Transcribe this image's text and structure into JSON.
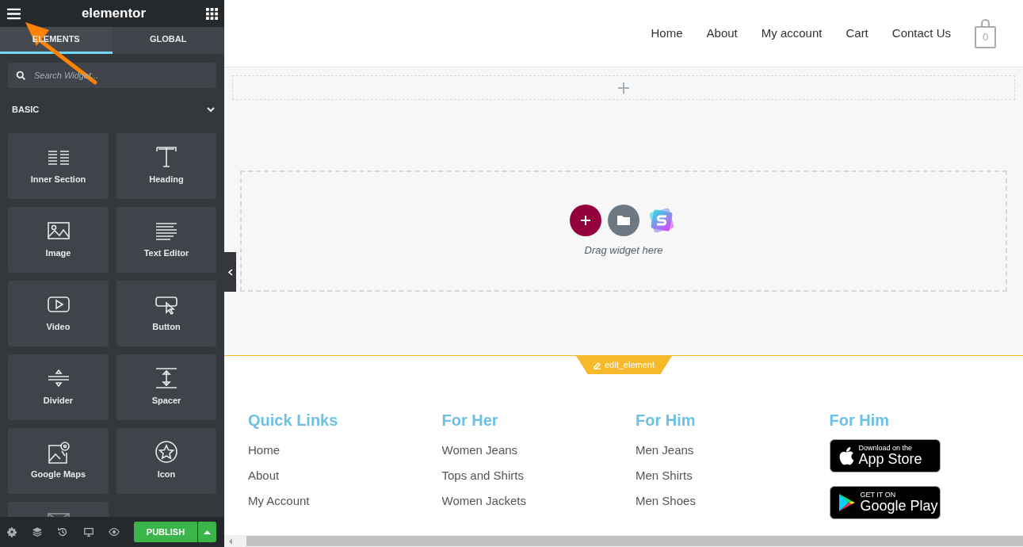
{
  "sidebar": {
    "logo": "elementor",
    "tabs": [
      {
        "label": "ELEMENTS",
        "selected": true
      },
      {
        "label": "GLOBAL",
        "selected": false
      }
    ],
    "search": {
      "placeholder": "Search Widget..."
    },
    "category": {
      "label": "BASIC",
      "expanded": true
    },
    "widgets": [
      {
        "kind": "inner-section",
        "label": "Inner Section"
      },
      {
        "kind": "heading",
        "label": "Heading"
      },
      {
        "kind": "image",
        "label": "Image"
      },
      {
        "kind": "text-editor",
        "label": "Text Editor"
      },
      {
        "kind": "video",
        "label": "Video"
      },
      {
        "kind": "button",
        "label": "Button"
      },
      {
        "kind": "divider",
        "label": "Divider"
      },
      {
        "kind": "spacer",
        "label": "Spacer"
      },
      {
        "kind": "google-maps",
        "label": "Google Maps"
      },
      {
        "kind": "icon",
        "label": "Icon"
      },
      {
        "kind": "envelope"
      }
    ],
    "publish": "PUBLISH"
  },
  "preview": {
    "nav": [
      "Home",
      "About",
      "My account",
      "Cart",
      "Contact Us"
    ],
    "cart_count": "0",
    "drop_hint": "Drag widget here",
    "edit_tab": "edit_element",
    "footer_columns": [
      {
        "heading": "Quick Links",
        "links": [
          "Home",
          "About",
          "My Account"
        ]
      },
      {
        "heading": "For Her",
        "links": [
          "Women Jeans",
          "Tops and Shirts",
          "Women Jackets"
        ]
      },
      {
        "heading": "For Him",
        "links": [
          "Men Jeans",
          "Men Shirts",
          "Men Shoes"
        ]
      },
      {
        "heading": "For Him",
        "badges": [
          {
            "kind": "apple",
            "small": "Download on the",
            "big": "App Store"
          },
          {
            "kind": "google",
            "small": "GET IT ON",
            "big": "Google Play"
          }
        ]
      }
    ]
  }
}
